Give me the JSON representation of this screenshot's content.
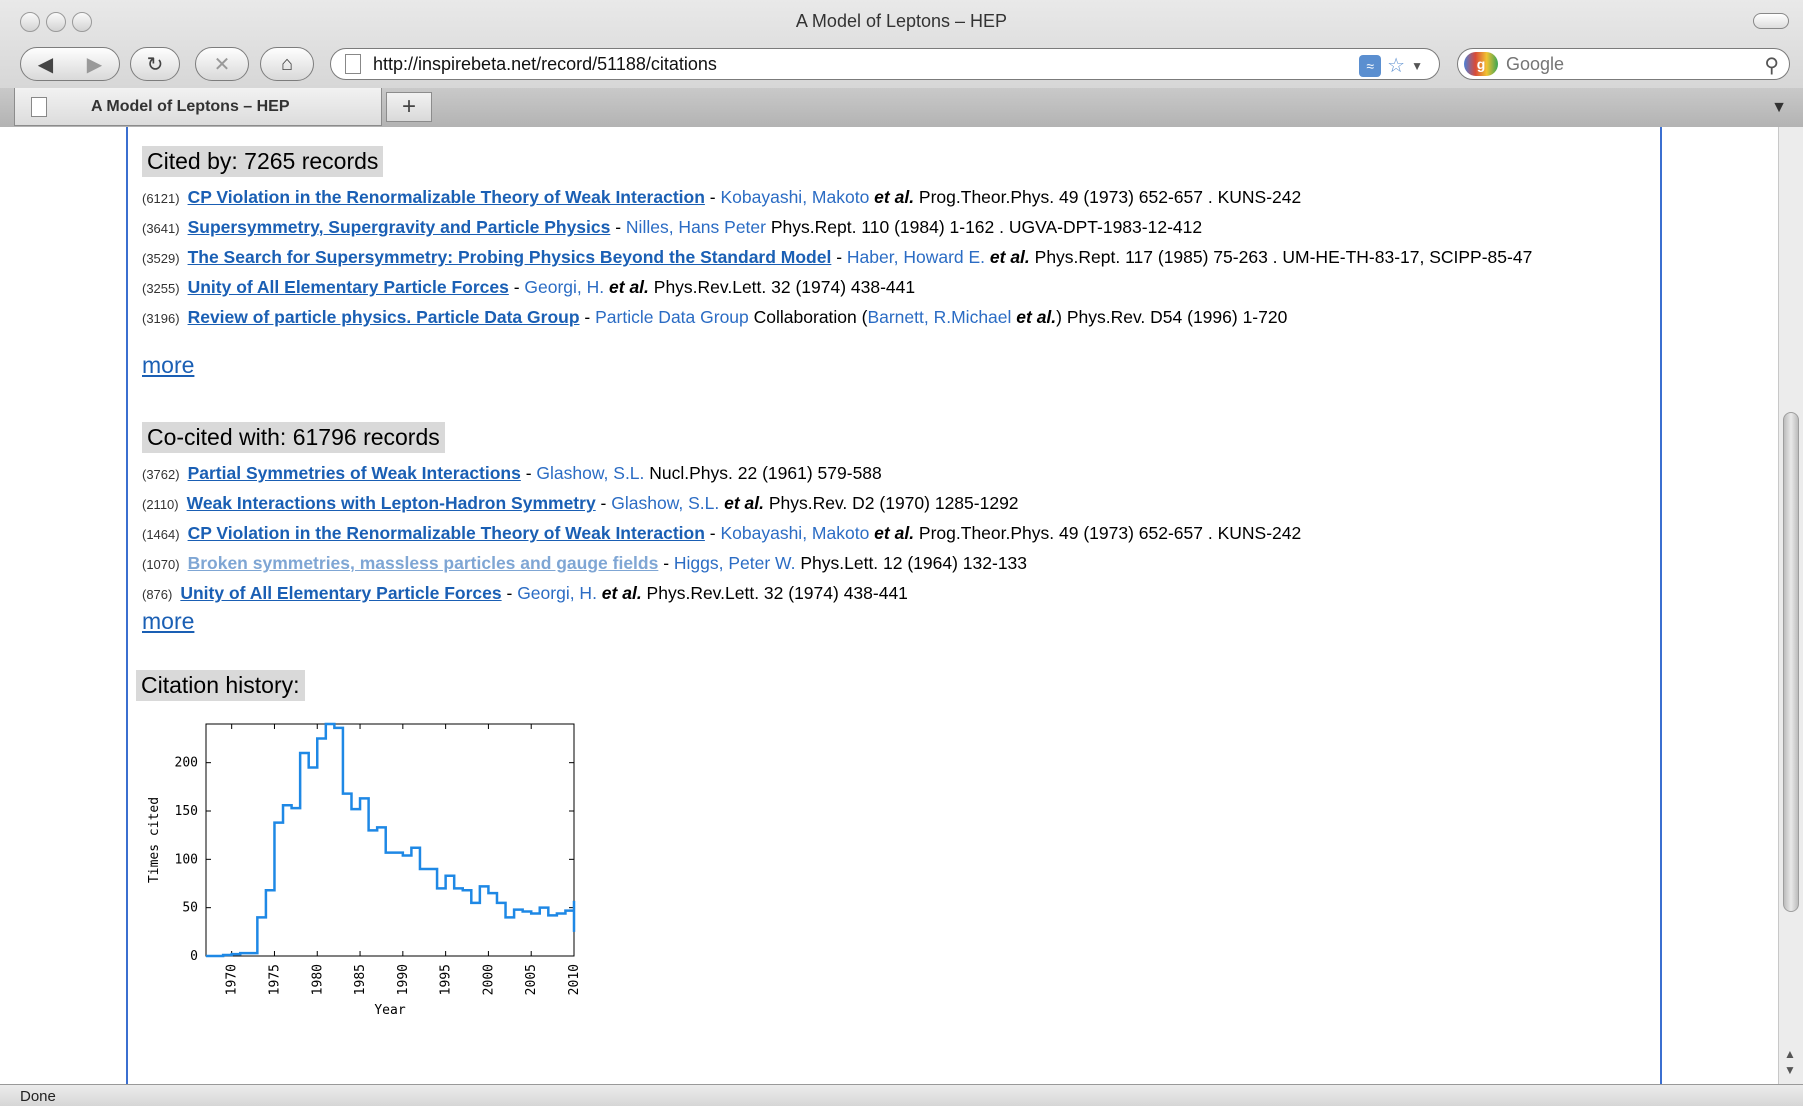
{
  "window": {
    "title": "A Model of Leptons – HEP"
  },
  "toolbar": {
    "url": "http://inspirebeta.net/record/51188/citations",
    "search_placeholder": "Google"
  },
  "tabs": [
    {
      "label": "A Model of Leptons – HEP"
    }
  ],
  "status": "Done",
  "cited_by": {
    "heading": "Cited by: 7265 records",
    "records": [
      {
        "count": "(6121)",
        "title": "CP Violation in the Renormalizable Theory of Weak Interaction",
        "sep": " - ",
        "authors": "Kobayashi, Makoto",
        "etal": " et al.",
        "ref": " Prog.Theor.Phys. 49 (1973) 652-657 . KUNS-242"
      },
      {
        "count": "(3641)",
        "title": "Supersymmetry, Supergravity and Particle Physics",
        "sep": " - ",
        "authors": "Nilles, Hans Peter",
        "etal": "",
        "ref": " Phys.Rept. 110 (1984) 1-162 . UGVA-DPT-1983-12-412"
      },
      {
        "count": "(3529)",
        "title": "The Search for Supersymmetry: Probing Physics Beyond the Standard Model",
        "sep": " - ",
        "authors": "Haber, Howard E.",
        "etal": " et al.",
        "ref": " Phys.Rept. 117 (1985) 75-263 . UM-HE-TH-83-17, SCIPP-85-47"
      },
      {
        "count": "(3255)",
        "title": "Unity of All Elementary Particle Forces",
        "sep": " - ",
        "authors": "Georgi, H.",
        "etal": " et al.",
        "ref": " Phys.Rev.Lett. 32 (1974) 438-441"
      },
      {
        "count": "(3196)",
        "title": "Review of particle physics. Particle Data Group",
        "sep": " - ",
        "authors": "Particle Data Group",
        "etal": "",
        "ref": " Collaboration (",
        "authors2": "Barnett, R.Michael",
        "etal2": " et al.",
        "ref2": ") Phys.Rev. D54 (1996) 1-720"
      }
    ],
    "more_label": "more"
  },
  "cocited": {
    "heading": "Co-cited with: 61796 records",
    "records": [
      {
        "count": "(3762)",
        "title": "Partial Symmetries of Weak Interactions",
        "sep": " - ",
        "authors": "Glashow, S.L.",
        "etal": "",
        "ref": " Nucl.Phys. 22 (1961) 579-588"
      },
      {
        "count": "(2110)",
        "title": "Weak Interactions with Lepton-Hadron Symmetry",
        "sep": " - ",
        "authors": "Glashow, S.L.",
        "etal": " et al.",
        "ref": " Phys.Rev. D2 (1970) 1285-1292"
      },
      {
        "count": "(1464)",
        "title": "CP Violation in the Renormalizable Theory of Weak Interaction",
        "sep": " - ",
        "authors": "Kobayashi, Makoto",
        "etal": " et al.",
        "ref": " Prog.Theor.Phys. 49 (1973) 652-657 . KUNS-242"
      },
      {
        "count": "(1070)",
        "title": "Broken symmetries, massless particles and gauge fields",
        "sep": " - ",
        "authors": "Higgs, Peter W.",
        "etal": "",
        "ref": " Phys.Lett. 12 (1964) 132-133",
        "visited": true
      },
      {
        "count": "(876)",
        "title": "Unity of All Elementary Particle Forces",
        "sep": " - ",
        "authors": "Georgi, H.",
        "etal": " et al.",
        "ref": " Phys.Rev.Lett. 32 (1974) 438-441"
      }
    ],
    "more_label": "more"
  },
  "history": {
    "heading": "Citation history:"
  },
  "chart_data": {
    "type": "line",
    "style": "step",
    "title": "",
    "xlabel": "Year",
    "ylabel": "Times cited",
    "xlim": [
      1967,
      2010
    ],
    "ylim": [
      0,
      240
    ],
    "xticks": [
      "1970",
      "1975",
      "1980",
      "1985",
      "1990",
      "1995",
      "2000",
      "2005",
      "2010"
    ],
    "yticks": [
      "0",
      "50",
      "100",
      "150",
      "200"
    ],
    "color": "#1e88e5",
    "x": [
      1967,
      1968,
      1969,
      1970,
      1971,
      1972,
      1973,
      1974,
      1975,
      1976,
      1977,
      1978,
      1979,
      1980,
      1981,
      1982,
      1983,
      1984,
      1985,
      1986,
      1987,
      1988,
      1989,
      1990,
      1991,
      1992,
      1993,
      1994,
      1995,
      1996,
      1997,
      1998,
      1999,
      2000,
      2001,
      2002,
      2003,
      2004,
      2005,
      2006,
      2007,
      2008,
      2009,
      2010
    ],
    "values": [
      0,
      0,
      1,
      2,
      3,
      3,
      40,
      68,
      138,
      156,
      153,
      210,
      195,
      225,
      240,
      236,
      168,
      152,
      163,
      130,
      133,
      107,
      107,
      104,
      112,
      90,
      90,
      70,
      83,
      70,
      68,
      55,
      72,
      65,
      55,
      40,
      48,
      46,
      44,
      50,
      42,
      44,
      47,
      57
    ]
  }
}
